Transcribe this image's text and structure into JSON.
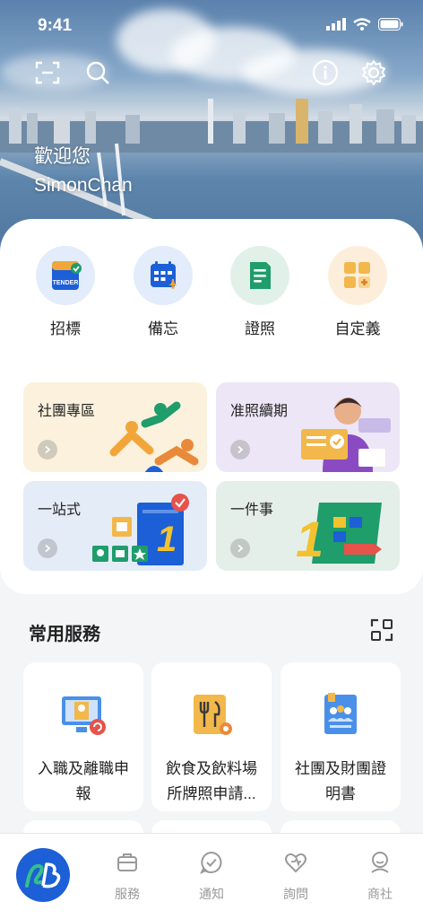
{
  "status_bar": {
    "time": "9:41"
  },
  "hero": {
    "welcome_line1": "歡迎您",
    "welcome_line2": "SimonChan"
  },
  "quick_actions": [
    {
      "label": "招標",
      "icon": "tender-icon",
      "badge_text": "TENDER"
    },
    {
      "label": "備忘",
      "icon": "calendar-icon"
    },
    {
      "label": "證照",
      "icon": "document-icon"
    },
    {
      "label": "自定義",
      "icon": "custom-grid-icon"
    }
  ],
  "tiles": [
    {
      "title": "社團專區",
      "bg": "#fbf1dd"
    },
    {
      "title": "准照續期",
      "bg": "#ece6f6"
    },
    {
      "title": "一站式",
      "bg": "#e4ecf8"
    },
    {
      "title": "一件事",
      "bg": "#e5efe9"
    }
  ],
  "common_services": {
    "title": "常用服務",
    "items": [
      {
        "label": "入職及離職申報"
      },
      {
        "label": "飲食及飲料場所牌照申請..."
      },
      {
        "label": "社團及財團證明書"
      }
    ]
  },
  "bottom_nav": {
    "items": [
      {
        "label": "服務",
        "icon": "briefcase-icon"
      },
      {
        "label": "通知",
        "icon": "chat-check-icon"
      },
      {
        "label": "詢問",
        "icon": "heart-chat-icon"
      },
      {
        "label": "商社",
        "icon": "person-icon"
      }
    ]
  },
  "colors": {
    "accent_blue": "#1c5fd6",
    "green": "#1f9d6b",
    "orange": "#f2a63a"
  }
}
